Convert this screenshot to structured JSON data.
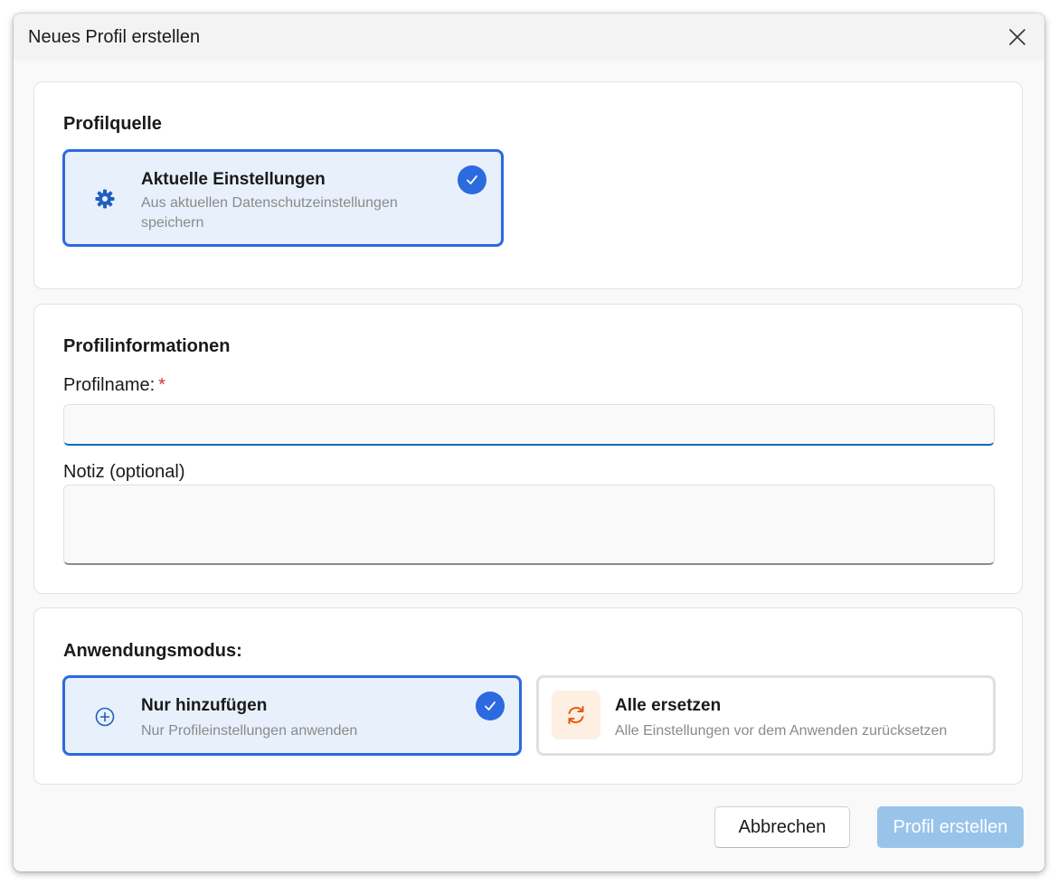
{
  "dialog": {
    "title": "Neues Profil erstellen",
    "close_icon": "close-icon"
  },
  "source_section": {
    "title": "Profilquelle",
    "option": {
      "title": "Aktuelle Einstellungen",
      "description": "Aus aktuellen Datenschutzeinstellungen speichern",
      "icon": "gear-icon",
      "selected": true
    }
  },
  "info_section": {
    "title": "Profilinformationen",
    "name_label": "Profilname:",
    "required_marker": "*",
    "name_value": "",
    "note_label": "Notiz (optional)",
    "note_value": ""
  },
  "mode_section": {
    "title": "Anwendungsmodus:",
    "options": [
      {
        "title": "Nur hinzufügen",
        "description": "Nur Profileinstellungen anwenden",
        "icon": "plus-circle-icon",
        "selected": true
      },
      {
        "title": "Alle ersetzen",
        "description": "Alle Einstellungen vor dem Anwenden zurücksetzen",
        "icon": "refresh-icon",
        "selected": false
      }
    ]
  },
  "footer": {
    "cancel_label": "Abbrechen",
    "create_label": "Profil erstellen"
  },
  "colors": {
    "accent": "#2b6adf",
    "primary_disabled": "#99c4ea",
    "required": "#d13438",
    "replace_icon": "#e8590c"
  }
}
